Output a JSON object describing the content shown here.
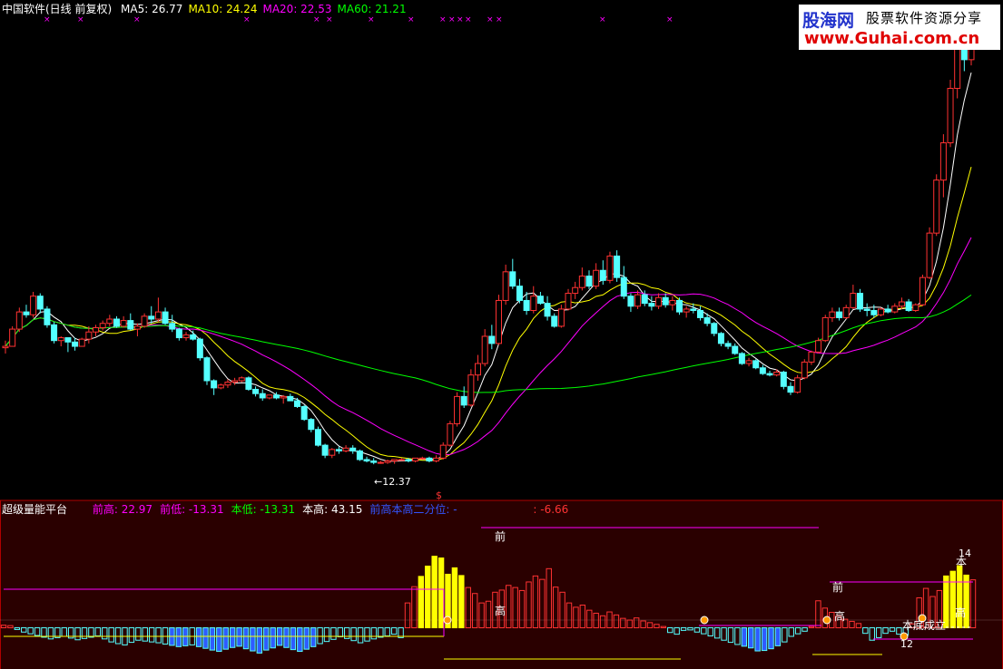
{
  "main_legend": {
    "title": "中国软件(日线 前复权)",
    "ma": [
      {
        "label": "MA5:",
        "value": "26.77",
        "color": "#ffffff"
      },
      {
        "label": "MA10:",
        "value": "24.24",
        "color": "#ffff00"
      },
      {
        "label": "MA20:",
        "value": "22.53",
        "color": "#ff00ff"
      },
      {
        "label": "MA60:",
        "value": "21.21",
        "color": "#00ff00"
      }
    ]
  },
  "low_marker": "12.37",
  "signal_marker": "$",
  "sub_legend": {
    "title": "超级量能平台",
    "items": [
      {
        "label": "前高:",
        "value": "22.97",
        "color": "#ff00ff"
      },
      {
        "label": "前低:",
        "value": "-13.31",
        "color": "#ff00ff"
      },
      {
        "label": "本低:",
        "value": "-13.31",
        "color": "#00ff00"
      },
      {
        "label": "本高:",
        "value": "43.15",
        "color": "#ffffff"
      },
      {
        "label": "前高本高二分位:",
        "value": "-",
        "color": "#3355ff"
      }
    ],
    "extra": ": -6.66",
    "extra_color": "#ff3333"
  },
  "annotations": {
    "qian": "前",
    "gao": "高",
    "ben": "本",
    "num14": "14",
    "num12": "12",
    "confirm": "本底成立"
  },
  "watermark": {
    "logo": "股海网",
    "slogan": "股票软件资源分享",
    "url": "www.Guhai.com.cn"
  },
  "colors": {
    "up": "#ff3232",
    "down": "#54ffff",
    "ma5": "#ffffff",
    "ma10": "#ffff00",
    "ma20": "#ff00ff",
    "ma60": "#00ff00",
    "panel_border": "#b00000",
    "sub_bg": "#2a0000"
  },
  "chart_data": {
    "type": "candlestick",
    "candles": [
      [
        20.5,
        21.0,
        20.1,
        20.6
      ],
      [
        20.6,
        22.0,
        20.6,
        21.8
      ],
      [
        21.8,
        23.3,
        21.6,
        23.0
      ],
      [
        23.0,
        23.5,
        22.6,
        22.8
      ],
      [
        22.8,
        24.4,
        22.6,
        24.1
      ],
      [
        24.1,
        24.3,
        22.9,
        23.2
      ],
      [
        23.2,
        23.4,
        21.9,
        22.1
      ],
      [
        22.1,
        22.3,
        20.8,
        21.0
      ],
      [
        21.0,
        21.3,
        20.6,
        21.2
      ],
      [
        21.2,
        21.2,
        20.2,
        20.9
      ],
      [
        20.9,
        21.2,
        20.3,
        20.6
      ],
      [
        20.6,
        21.2,
        20.6,
        21.1
      ],
      [
        21.1,
        22.0,
        20.8,
        21.6
      ],
      [
        21.6,
        22.1,
        21.3,
        21.9
      ],
      [
        21.9,
        22.4,
        21.7,
        22.2
      ],
      [
        22.2,
        22.8,
        22.0,
        22.5
      ],
      [
        22.5,
        22.7,
        21.9,
        22.0
      ],
      [
        22.0,
        22.7,
        21.9,
        22.4
      ],
      [
        22.4,
        22.9,
        21.7,
        21.8
      ],
      [
        21.8,
        22.2,
        21.3,
        22.0
      ],
      [
        22.0,
        22.9,
        21.9,
        22.7
      ],
      [
        22.7,
        23.4,
        22.2,
        22.5
      ],
      [
        22.5,
        24.0,
        22.3,
        23.0
      ],
      [
        23.0,
        23.3,
        22.1,
        22.2
      ],
      [
        22.2,
        22.8,
        21.6,
        21.8
      ],
      [
        21.8,
        21.9,
        21.0,
        21.2
      ],
      [
        21.2,
        21.6,
        21.0,
        21.4
      ],
      [
        21.4,
        21.7,
        21.0,
        21.1
      ],
      [
        21.1,
        21.2,
        19.6,
        19.8
      ],
      [
        19.8,
        19.9,
        17.9,
        18.2
      ],
      [
        18.2,
        18.3,
        17.2,
        17.7
      ],
      [
        17.7,
        18.0,
        17.6,
        17.9
      ],
      [
        17.9,
        18.3,
        17.7,
        18.1
      ],
      [
        18.1,
        18.4,
        17.9,
        18.2
      ],
      [
        18.2,
        18.5,
        18.1,
        18.4
      ],
      [
        18.4,
        18.5,
        17.5,
        17.6
      ],
      [
        17.6,
        17.8,
        17.1,
        17.3
      ],
      [
        17.3,
        17.6,
        16.8,
        17.0
      ],
      [
        17.0,
        17.2,
        16.9,
        17.2
      ],
      [
        17.2,
        17.4,
        16.9,
        17.0
      ],
      [
        17.0,
        17.2,
        16.6,
        17.1
      ],
      [
        17.1,
        17.3,
        16.8,
        16.8
      ],
      [
        16.8,
        17.0,
        16.3,
        16.4
      ],
      [
        16.4,
        16.5,
        15.4,
        15.5
      ],
      [
        15.5,
        15.6,
        14.6,
        14.8
      ],
      [
        14.8,
        15.0,
        13.6,
        13.7
      ],
      [
        13.7,
        13.8,
        12.8,
        13.0
      ],
      [
        13.0,
        13.5,
        12.8,
        13.4
      ],
      [
        13.4,
        13.6,
        13.1,
        13.3
      ],
      [
        13.3,
        13.7,
        13.2,
        13.5
      ],
      [
        13.5,
        13.7,
        13.1,
        13.3
      ],
      [
        13.3,
        13.4,
        12.6,
        12.7
      ],
      [
        12.7,
        12.9,
        12.5,
        12.6
      ],
      [
        12.6,
        12.8,
        12.37,
        12.5
      ],
      [
        12.5,
        12.6,
        12.4,
        12.5
      ],
      [
        12.5,
        12.7,
        12.4,
        12.6
      ],
      [
        12.6,
        12.7,
        12.4,
        12.7
      ],
      [
        12.7,
        12.8,
        12.6,
        12.7
      ],
      [
        12.7,
        12.8,
        12.5,
        12.6
      ],
      [
        12.6,
        12.8,
        12.5,
        12.8
      ],
      [
        12.8,
        12.9,
        12.7,
        12.8
      ],
      [
        12.8,
        12.9,
        12.5,
        12.6
      ],
      [
        12.6,
        13.0,
        12.5,
        12.8
      ],
      [
        12.8,
        13.9,
        12.7,
        13.7
      ],
      [
        13.7,
        15.4,
        13.6,
        15.2
      ],
      [
        15.2,
        17.4,
        15.0,
        17.1
      ],
      [
        17.1,
        17.8,
        16.3,
        16.5
      ],
      [
        16.5,
        19.0,
        16.4,
        18.6
      ],
      [
        18.6,
        20.0,
        18.2,
        19.4
      ],
      [
        19.4,
        21.8,
        19.2,
        21.3
      ],
      [
        21.3,
        22.1,
        20.4,
        20.8
      ],
      [
        20.8,
        24.2,
        20.7,
        23.8
      ],
      [
        23.8,
        26.3,
        23.5,
        25.8
      ],
      [
        25.8,
        26.7,
        24.6,
        24.8
      ],
      [
        24.8,
        25.3,
        23.6,
        23.8
      ],
      [
        23.8,
        24.4,
        22.8,
        23.1
      ],
      [
        23.1,
        24.8,
        22.9,
        24.1
      ],
      [
        24.1,
        24.4,
        23.5,
        23.6
      ],
      [
        23.6,
        24.1,
        22.4,
        22.7
      ],
      [
        22.7,
        22.9,
        21.9,
        22.0
      ],
      [
        22.0,
        23.5,
        21.9,
        23.2
      ],
      [
        23.2,
        24.6,
        23.1,
        24.3
      ],
      [
        24.3,
        25.1,
        23.9,
        24.7
      ],
      [
        24.7,
        26.1,
        24.5,
        25.5
      ],
      [
        25.5,
        25.9,
        24.6,
        24.8
      ],
      [
        24.8,
        26.4,
        24.6,
        25.9
      ],
      [
        25.9,
        26.6,
        24.9,
        25.2
      ],
      [
        25.2,
        27.2,
        25.0,
        26.9
      ],
      [
        26.9,
        27.3,
        25.1,
        25.4
      ],
      [
        25.4,
        26.2,
        23.9,
        24.1
      ],
      [
        24.1,
        24.3,
        23.0,
        23.4
      ],
      [
        23.4,
        24.5,
        23.2,
        24.2
      ],
      [
        24.2,
        24.5,
        23.4,
        23.6
      ],
      [
        23.6,
        24.1,
        23.1,
        23.4
      ],
      [
        23.4,
        24.3,
        23.2,
        24.0
      ],
      [
        24.0,
        24.3,
        23.3,
        23.5
      ],
      [
        23.5,
        24.1,
        23.1,
        23.8
      ],
      [
        23.8,
        24.0,
        22.8,
        23.0
      ],
      [
        23.0,
        23.4,
        22.6,
        23.2
      ],
      [
        23.2,
        23.6,
        22.9,
        23.1
      ],
      [
        23.1,
        23.4,
        22.4,
        22.6
      ],
      [
        22.6,
        22.9,
        22.0,
        22.2
      ],
      [
        22.2,
        22.3,
        21.3,
        21.5
      ],
      [
        21.5,
        21.6,
        20.6,
        20.8
      ],
      [
        20.8,
        21.0,
        20.4,
        20.6
      ],
      [
        20.6,
        20.8,
        20.0,
        20.1
      ],
      [
        20.1,
        20.2,
        19.3,
        19.4
      ],
      [
        19.4,
        19.8,
        19.2,
        19.6
      ],
      [
        19.6,
        19.7,
        19.0,
        19.1
      ],
      [
        19.1,
        19.3,
        18.6,
        18.7
      ],
      [
        18.7,
        18.9,
        18.5,
        18.6
      ],
      [
        18.6,
        19.0,
        18.5,
        18.8
      ],
      [
        18.8,
        18.9,
        17.6,
        17.8
      ],
      [
        17.8,
        18.1,
        17.2,
        17.4
      ],
      [
        17.4,
        18.6,
        17.3,
        18.4
      ],
      [
        18.4,
        19.7,
        18.3,
        19.5
      ],
      [
        19.5,
        20.3,
        19.3,
        20.2
      ],
      [
        20.2,
        21.2,
        20.1,
        21.0
      ],
      [
        21.0,
        22.8,
        20.9,
        22.6
      ],
      [
        22.6,
        23.3,
        22.3,
        23.0
      ],
      [
        23.0,
        23.3,
        22.4,
        22.6
      ],
      [
        22.6,
        23.5,
        22.5,
        23.3
      ],
      [
        23.3,
        24.9,
        23.2,
        24.3
      ],
      [
        24.3,
        24.6,
        23.0,
        23.2
      ],
      [
        23.2,
        23.6,
        22.7,
        23.1
      ],
      [
        23.1,
        23.5,
        22.6,
        22.8
      ],
      [
        22.8,
        23.3,
        22.7,
        23.2
      ],
      [
        23.2,
        23.5,
        22.9,
        23.0
      ],
      [
        23.0,
        23.6,
        22.9,
        23.4
      ],
      [
        23.4,
        24.0,
        23.2,
        23.7
      ],
      [
        23.7,
        23.9,
        23.0,
        23.1
      ],
      [
        23.1,
        23.6,
        23.0,
        23.5
      ],
      [
        23.5,
        25.6,
        23.4,
        25.4
      ],
      [
        25.4,
        28.9,
        25.3,
        28.5
      ],
      [
        28.5,
        32.6,
        28.3,
        32.2
      ],
      [
        32.2,
        35.4,
        31.0,
        34.8
      ],
      [
        34.8,
        39.2,
        34.5,
        38.6
      ],
      [
        38.6,
        43.15,
        37.9,
        42.6
      ],
      [
        42.6,
        43.0,
        39.8,
        40.6
      ],
      [
        40.6,
        42.7,
        40.2,
        41.9
      ]
    ],
    "ylim": [
      12.0,
      43.5
    ]
  },
  "sub_chart_data": {
    "type": "bar",
    "values": [
      0.6,
      0.5,
      -0.4,
      -1.0,
      -1.4,
      -1.8,
      -2.2,
      -2.6,
      -2.3,
      -2.0,
      -2.4,
      -2.8,
      -2.5,
      -2.2,
      -1.9,
      -2.6,
      -3.3,
      -3.7,
      -4.0,
      -3.4,
      -2.9,
      -3.1,
      -3.3,
      -3.5,
      -3.8,
      -4.1,
      -4.4,
      -4.2,
      -4.0,
      -4.4,
      -4.8,
      -5.2,
      -5.5,
      -5.0,
      -4.6,
      -4.3,
      -4.9,
      -5.4,
      -5.9,
      -5.2,
      -4.7,
      -4.1,
      -4.6,
      -5.1,
      -5.5,
      -5.0,
      -4.4,
      -3.7,
      -3.2,
      -2.7,
      -2.1,
      -2.5,
      -3.0,
      -3.5,
      -3.1,
      -2.6,
      -2.2,
      -1.9,
      -1.5,
      -2.3,
      5.8,
      9.6,
      12.0,
      14.4,
      16.7,
      16.3,
      12.5,
      14.0,
      12.2,
      9.4,
      8.0,
      5.8,
      6.2,
      8.3,
      8.8,
      9.9,
      9.4,
      8.7,
      10.7,
      12.1,
      11.3,
      13.8,
      9.5,
      8.3,
      5.8,
      4.8,
      5.3,
      4.1,
      3.4,
      2.8,
      3.7,
      3.0,
      2.2,
      1.8,
      2.3,
      1.6,
      1.2,
      0.8,
      0.3,
      -1.1,
      -1.5,
      -0.6,
      -0.5,
      -1.0,
      -1.4,
      -1.9,
      -2.4,
      -2.9,
      -3.4,
      -3.9,
      -4.3,
      -4.7,
      -5.4,
      -5.3,
      -4.9,
      -4.2,
      -3.3,
      -2.0,
      -1.4,
      -0.8,
      0.3,
      6.3,
      4.6,
      3.6,
      2.7,
      2.0,
      1.5,
      1.0,
      -1.3,
      -2.9,
      -2.3,
      -1.3,
      -0.8,
      -1.5,
      -1.7,
      0.9,
      7.0,
      9.2,
      7.3,
      8.7,
      12.1,
      13.2,
      14.5,
      12.3,
      11.2
    ],
    "ylim": [
      -6.66,
      22.97
    ]
  }
}
